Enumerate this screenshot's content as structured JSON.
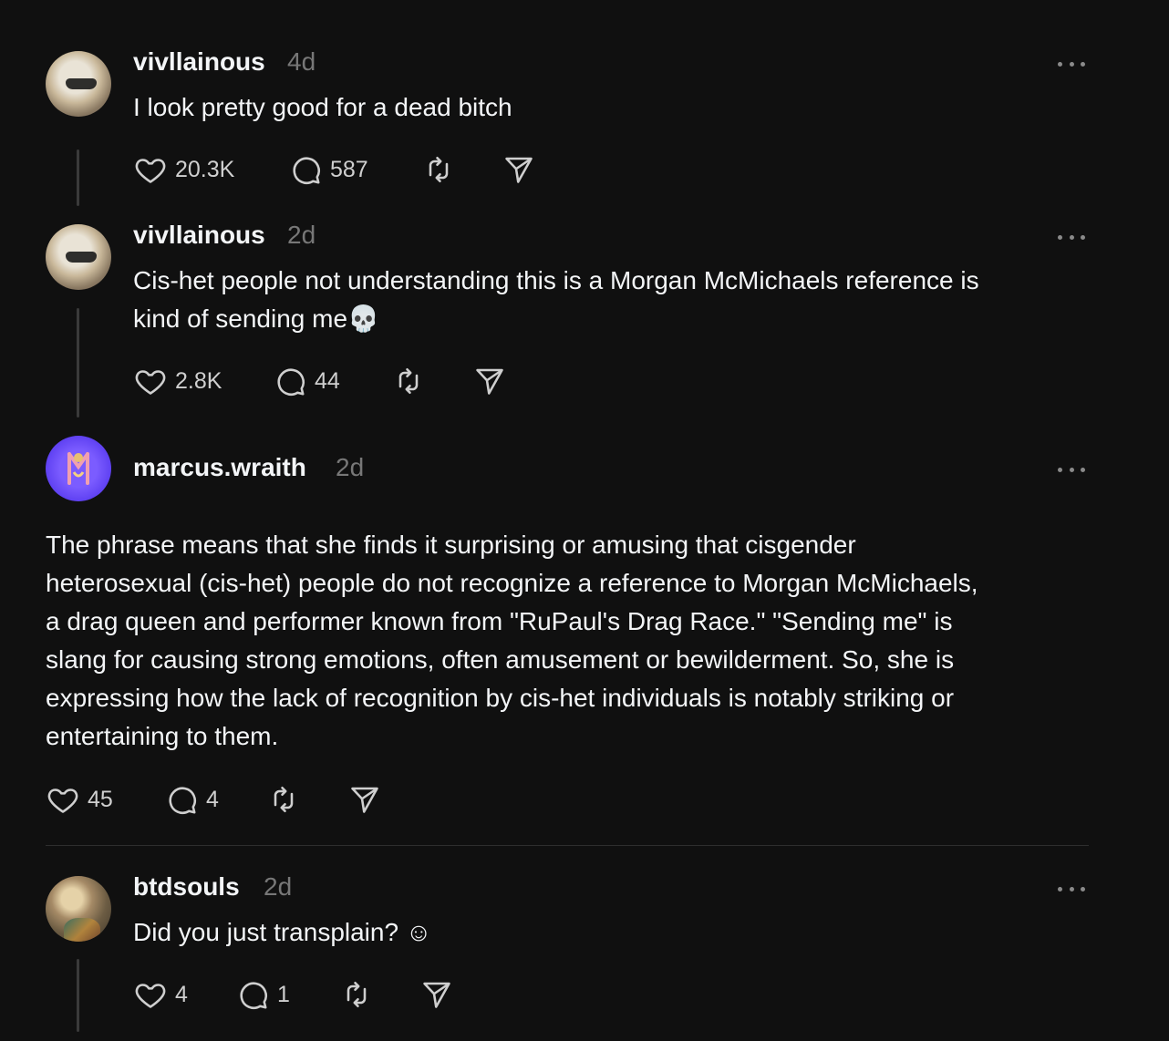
{
  "posts": [
    {
      "username": "vivllainous",
      "time": "4d",
      "text": "I look pretty good for a dead bitch",
      "likes": "20.3K",
      "replies": "587"
    },
    {
      "username": "vivllainous",
      "time": "2d",
      "text_line1": "Cis-het people not understanding this is a Morgan McMichaels reference is",
      "text_line2": "kind of sending me💀",
      "likes": "2.8K",
      "replies": "44"
    },
    {
      "username": "marcus.wraith",
      "time": "2d",
      "lines": [
        "The phrase means that she finds it surprising or amusing that cisgender",
        "heterosexual (cis-het) people do not recognize a reference to Morgan McMichaels,",
        "a drag queen and performer known from \"RuPaul's Drag Race.\" \"Sending me\" is",
        "slang for causing strong emotions, often amusement or bewilderment. So, she is",
        "expressing how the lack of recognition by cis-het individuals is notably striking or",
        "entertaining to them."
      ],
      "likes": "45",
      "replies": "4"
    },
    {
      "username": "btdsouls",
      "time": "2d",
      "text": "Did you just transplain? ☺",
      "likes": "4",
      "replies": "1"
    }
  ],
  "icons": {
    "like": "heart-icon",
    "reply": "comment-icon",
    "repost": "repost-icon",
    "share": "send-icon",
    "more": "more-icon"
  },
  "colors": {
    "background": "#101010",
    "text": "#f3f5f7",
    "muted": "#777777"
  }
}
